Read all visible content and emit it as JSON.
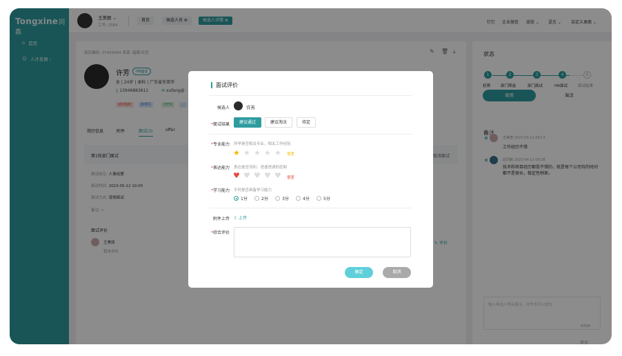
{
  "app": {
    "logo": "Tongxine",
    "logo_cn": "同鑫"
  },
  "sidebar": {
    "items": [
      {
        "label": "首页"
      },
      {
        "label": "人才发展 ›"
      }
    ]
  },
  "topbar": {
    "user_name": "王美丽  ⌄",
    "user_id": "工号: 2564",
    "tabs": [
      {
        "label": "首页"
      },
      {
        "label": "候选人员 ⊗"
      },
      {
        "label": "候选人详情 ⊗"
      }
    ],
    "right": [
      "钉钉",
      "企业微信",
      "皮肤 ⌄",
      "语言 ⌄",
      "自定义桌面 ⌄"
    ]
  },
  "main": {
    "header_meta": "简历编码: 37403064    来源: 猎聘/无忧",
    "candidate_name": "许芳",
    "candidate_tag": "HR面试",
    "info": "女 | 24岁 | 本科 | 广东省东莞市",
    "phone": "13946883611",
    "email": "xufang@",
    "badges": [
      "985院校",
      "高学历",
      "CET6",
      "..."
    ],
    "tabs": [
      "简历信息",
      "附件",
      "面试(3)",
      "offer"
    ],
    "section_title": "第1轮部门面试",
    "cancel_label": "取消面试",
    "rows": [
      {
        "k": "面试岗位:",
        "v": "人事经理"
      },
      {
        "k": "面试时间:",
        "v": "2023-05-12 10:00"
      },
      {
        "k": "面试方式:",
        "v": "现场面试"
      },
      {
        "k": "备注:",
        "v": "--"
      }
    ],
    "eval_title": "面试评价",
    "evaluator": "王美丽",
    "eval_status": "暂未评价",
    "eval_link": "评价"
  },
  "right_panel": {
    "status_title": "状态",
    "steps": [
      {
        "num": "1",
        "label": "初筛"
      },
      {
        "num": "2",
        "label": "部门筛选"
      },
      {
        "num": "3",
        "label": "部门面试"
      },
      {
        "num": "4",
        "label": "HR面试"
      },
      {
        "num": "5",
        "label": "面试结果"
      }
    ],
    "hire_btn": "录用",
    "reject_btn": "淘汰",
    "notes_title": "备注",
    "notes": [
      {
        "author": "王美丽",
        "time": "2023-03-11 09:13",
        "text": "工作经历不错"
      },
      {
        "author": "段同薇",
        "time": "2023-04-12 09:38",
        "text": "技术和项目经历都挺不错的，就是每个公司待的时间都不是很长，稳定性稍差。"
      }
    ],
    "note_placeholder": "输入候选人相关备注，回车也可以提交",
    "note_count": "0/500",
    "submit": "提交"
  },
  "modal": {
    "title": "面试评价",
    "candidate_label": "候选人",
    "candidate_name": "许芳",
    "result_label": "面试结果",
    "result_options": [
      {
        "label": "建议通过",
        "selected": true
      },
      {
        "label": "建议淘汰",
        "selected": false
      },
      {
        "label": "待定",
        "selected": false
      }
    ],
    "professional_label": "专业能力",
    "professional_hint": "所学是否相关专业，相关工作经验",
    "professional_rating": 1,
    "professional_rating_text": "很差",
    "expression_label": "表达能力",
    "expression_hint": "表达是否流利，语速语调的控制",
    "expression_rating": 1,
    "expression_rating_text": "很差",
    "learning_label": "学习能力",
    "learning_hint": "平时是否具备学习能力",
    "learning_options": [
      "1分",
      "2分",
      "3分",
      "4分",
      "5分"
    ],
    "learning_selected": "1分",
    "attach_label": "附件上传",
    "upload_label": "上传",
    "summary_label": "综合评价",
    "confirm": "确定",
    "cancel": "取消"
  },
  "colors": {
    "accent": "#2e9c9f",
    "star": "#f5b800",
    "heart": "#e54d42"
  }
}
